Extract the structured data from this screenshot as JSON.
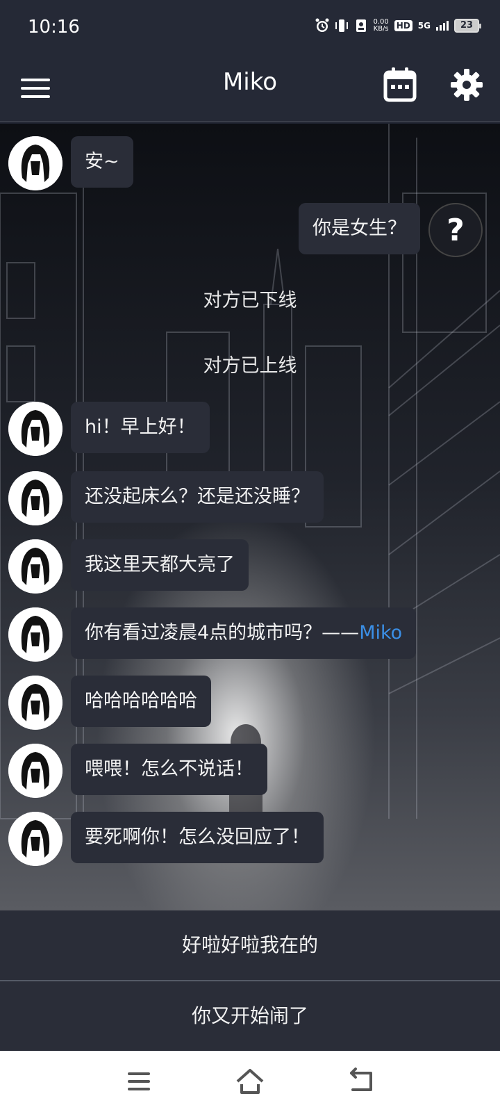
{
  "status_bar": {
    "time": "10:16",
    "net_speed_value": "0.00",
    "net_speed_unit": "KB/s",
    "hd_label": "HD",
    "network_label": "5G",
    "battery_level": "23"
  },
  "header": {
    "title": "Miko"
  },
  "chat": {
    "messages": [
      {
        "side": "left",
        "text": "安~"
      },
      {
        "side": "right",
        "text": "你是女生？"
      },
      {
        "side": "system",
        "text": "对方已下线"
      },
      {
        "side": "system",
        "text": "对方已上线"
      },
      {
        "side": "left",
        "text": "hi！早上好！"
      },
      {
        "side": "left",
        "text": "还没起床么？还是还没睡？"
      },
      {
        "side": "left",
        "text": "我这里天都大亮了"
      },
      {
        "side": "left",
        "text": "你有看过凌晨4点的城市吗？——",
        "signature": "Miko"
      },
      {
        "side": "left",
        "text": "哈哈哈哈哈哈"
      },
      {
        "side": "left",
        "text": "喂喂！怎么不说话！"
      },
      {
        "side": "left",
        "text": "要死啊你！怎么没回应了！"
      }
    ],
    "user_avatar_glyph": "?"
  },
  "replies": [
    {
      "label": "好啦好啦我在的"
    },
    {
      "label": "你又开始闹了"
    }
  ],
  "icons": {
    "menu": "hamburger-icon",
    "calendar": "calendar-icon",
    "settings": "gear-icon",
    "nav_recents": "menu-lines-icon",
    "nav_home": "home-icon",
    "nav_back": "back-arrow-icon"
  },
  "colors": {
    "header_bg": "#252936",
    "bubble_bg": "#2a2d38",
    "signature": "#3b8fe6"
  }
}
